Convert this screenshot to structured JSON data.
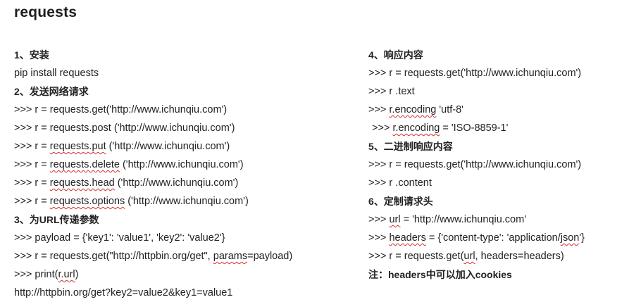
{
  "title": "requests",
  "left": [
    {
      "type": "head",
      "text": "1、安装"
    },
    {
      "type": "code",
      "parts": [
        {
          "t": "pip install requests"
        }
      ]
    },
    {
      "type": "head",
      "text": "2、发送网络请求"
    },
    {
      "type": "code",
      "parts": [
        {
          "t": ">>> r = requests.get('http://www.ichunqiu.com')"
        }
      ]
    },
    {
      "type": "code",
      "parts": [
        {
          "t": ">>> r = requests.post ('http://www.ichunqiu.com')"
        }
      ]
    },
    {
      "type": "code",
      "parts": [
        {
          "t": ">>> r = "
        },
        {
          "t": "requests.put",
          "u": true
        },
        {
          "t": " ('http://www.ichunqiu.com')"
        }
      ]
    },
    {
      "type": "code",
      "parts": [
        {
          "t": ">>> r = "
        },
        {
          "t": "requests.delete",
          "u": true
        },
        {
          "t": " ('http://www.ichunqiu.com')"
        }
      ]
    },
    {
      "type": "code",
      "parts": [
        {
          "t": ">>> r = "
        },
        {
          "t": "requests.head",
          "u": true
        },
        {
          "t": " ('http://www.ichunqiu.com')"
        }
      ]
    },
    {
      "type": "code",
      "parts": [
        {
          "t": ">>> r = "
        },
        {
          "t": "requests.options",
          "u": true
        },
        {
          "t": " ('http://www.ichunqiu.com')"
        }
      ]
    },
    {
      "type": "head",
      "text": "3、为URL传递参数"
    },
    {
      "type": "code",
      "parts": [
        {
          "t": ">>> payload = {'key1': 'value1', 'key2': 'value2'}"
        }
      ]
    },
    {
      "type": "code",
      "parts": [
        {
          "t": ">>> r = requests.get(\"http://httpbin.org/get\", "
        },
        {
          "t": "params",
          "u": true
        },
        {
          "t": "=payload)"
        }
      ]
    },
    {
      "type": "code",
      "parts": [
        {
          "t": ">>> print("
        },
        {
          "t": "r.url",
          "u": true
        },
        {
          "t": ")"
        }
      ]
    },
    {
      "type": "code",
      "parts": [
        {
          "t": "http://httpbin.org/get?key2=value2&key1=value1"
        }
      ]
    }
  ],
  "right": [
    {
      "type": "head",
      "text": "4、响应内容"
    },
    {
      "type": "code",
      "parts": [
        {
          "t": ">>> r = requests.get('http://www.ichunqiu.com')"
        }
      ]
    },
    {
      "type": "code",
      "parts": [
        {
          "t": ">>> r .text"
        }
      ]
    },
    {
      "type": "code",
      "parts": [
        {
          "t": ">>> "
        },
        {
          "t": "r.encoding",
          "u": true
        },
        {
          "t": " 'utf-8'"
        }
      ]
    },
    {
      "type": "code",
      "indent": true,
      "parts": [
        {
          "t": ">>> "
        },
        {
          "t": "r.encoding",
          "u": true
        },
        {
          "t": " = 'ISO-8859-1'"
        }
      ]
    },
    {
      "type": "head",
      "text": "5、二进制响应内容"
    },
    {
      "type": "code",
      "parts": [
        {
          "t": ">>> r = requests.get('http://www.ichunqiu.com')"
        }
      ]
    },
    {
      "type": "code",
      "parts": [
        {
          "t": ">>> r .content"
        }
      ]
    },
    {
      "type": "head",
      "text": "6、定制请求头"
    },
    {
      "type": "code",
      "parts": [
        {
          "t": ">>> "
        },
        {
          "t": "url",
          "u": true
        },
        {
          "t": " = 'http://www.ichunqiu.com'"
        }
      ]
    },
    {
      "type": "code",
      "parts": [
        {
          "t": ">>> "
        },
        {
          "t": "headers",
          "u": true
        },
        {
          "t": " = {'content-type': 'application/"
        },
        {
          "t": "json",
          "u": true
        },
        {
          "t": "'}"
        }
      ]
    },
    {
      "type": "code",
      "parts": [
        {
          "t": ">>> r = requests.get("
        },
        {
          "t": "url",
          "u": true
        },
        {
          "t": ", headers=headers)"
        }
      ]
    },
    {
      "type": "head",
      "text": "注：headers中可以加入cookies"
    }
  ]
}
